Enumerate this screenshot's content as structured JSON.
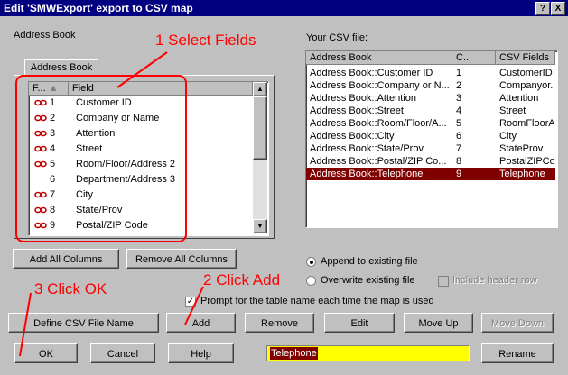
{
  "window": {
    "title": "Edit 'SMWExport' export to CSV map",
    "help_btn": "?",
    "close_btn": "X"
  },
  "left": {
    "group_label": "Address Book",
    "tab": "Address Book",
    "headers": {
      "flag": "F...",
      "field": "Field"
    },
    "rows": [
      {
        "num": "1",
        "field": "Customer ID",
        "linked": true
      },
      {
        "num": "2",
        "field": "Company or Name",
        "linked": true
      },
      {
        "num": "3",
        "field": "Attention",
        "linked": true
      },
      {
        "num": "4",
        "field": "Street",
        "linked": true
      },
      {
        "num": "5",
        "field": "Room/Floor/Address 2",
        "linked": true
      },
      {
        "num": "6",
        "field": "Department/Address 3",
        "linked": false
      },
      {
        "num": "7",
        "field": "City",
        "linked": true
      },
      {
        "num": "8",
        "field": "State/Prov",
        "linked": true
      },
      {
        "num": "9",
        "field": "Postal/ZIP Code",
        "linked": true
      }
    ],
    "add_all": "Add All Columns",
    "remove_all": "Remove All Columns"
  },
  "right": {
    "label": "Your CSV file:",
    "headers": {
      "source": "Address Book",
      "col": "C...",
      "csv": "CSV Fields"
    },
    "rows": [
      {
        "source": "Address Book::Customer ID",
        "col": "1",
        "csv": "CustomerID"
      },
      {
        "source": "Address Book::Company or N...",
        "col": "2",
        "csv": "Companyor..."
      },
      {
        "source": "Address Book::Attention",
        "col": "3",
        "csv": "Attention"
      },
      {
        "source": "Address Book::Street",
        "col": "4",
        "csv": "Street"
      },
      {
        "source": "Address Book::Room/Floor/A...",
        "col": "5",
        "csv": "RoomFloorA..."
      },
      {
        "source": "Address Book::City",
        "col": "6",
        "csv": "City"
      },
      {
        "source": "Address Book::State/Prov",
        "col": "7",
        "csv": "StateProv"
      },
      {
        "source": "Address Book::Postal/ZIP Co...",
        "col": "8",
        "csv": "PostalZIPCo..."
      },
      {
        "source": "Address Book::Telephone",
        "col": "9",
        "csv": "Telephone"
      }
    ],
    "selected_index": 8
  },
  "options": {
    "append": "Append to existing file",
    "overwrite": "Overwrite existing file",
    "include_header": "Include header row",
    "prompt": "Prompt for the table name each time the map is used",
    "prompt_checked": "✓"
  },
  "buttons": {
    "define_csv": "Define CSV File Name",
    "add": "Add",
    "remove": "Remove",
    "edit": "Edit",
    "move_up": "Move Up",
    "move_down": "Move Down",
    "ok": "OK",
    "cancel": "Cancel",
    "help": "Help",
    "rename": "Rename"
  },
  "name_field": {
    "value": "Telephone"
  },
  "annotations": {
    "step1": "1 Select Fields",
    "step2": "2 Click Add",
    "step3": "3 Click OK"
  },
  "colors": {
    "annotation": "#ff0000",
    "selection": "#800000",
    "name_field_bg": "#ffff00",
    "titlebar": "#000080"
  }
}
